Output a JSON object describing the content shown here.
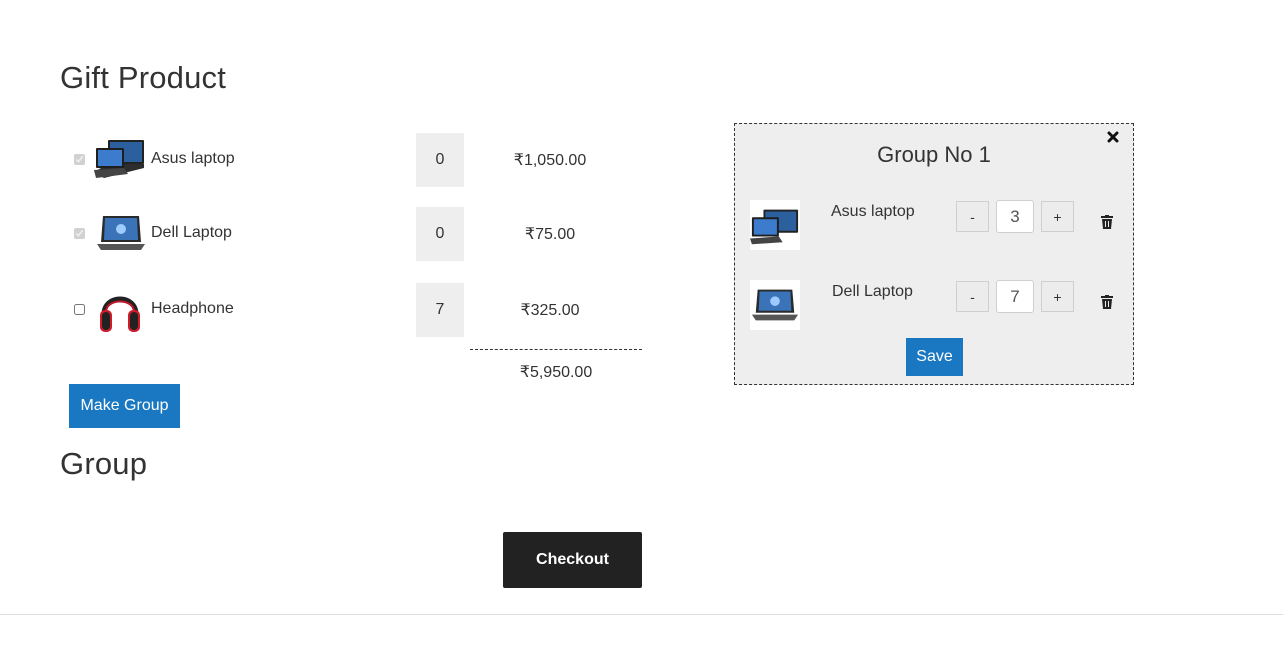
{
  "page": {
    "title": "Gift Product",
    "group_heading": "Group"
  },
  "products": [
    {
      "name": "Asus laptop",
      "checked": true,
      "qty": "0",
      "price": "₹1,050.00",
      "thumb": "laptop-icon"
    },
    {
      "name": "Dell Laptop",
      "checked": true,
      "qty": "0",
      "price": "₹75.00",
      "thumb": "laptop-icon"
    },
    {
      "name": "Headphone",
      "checked": false,
      "qty": "7",
      "price": "₹325.00",
      "thumb": "headphone-icon"
    }
  ],
  "total": "₹5,950.00",
  "make_group_label": "Make Group",
  "checkout_label": "Checkout",
  "group_panel": {
    "title": "Group No 1",
    "close_icon": "close-icon",
    "items": [
      {
        "name": "Asus laptop",
        "qty": "3",
        "minus": "-",
        "plus": "+"
      },
      {
        "name": "Dell Laptop",
        "qty": "7",
        "minus": "-",
        "plus": "+"
      }
    ],
    "save_label": "Save"
  },
  "colors": {
    "primary": "#1a78c2",
    "dark": "#222222",
    "panel_bg": "#eeeeee"
  }
}
